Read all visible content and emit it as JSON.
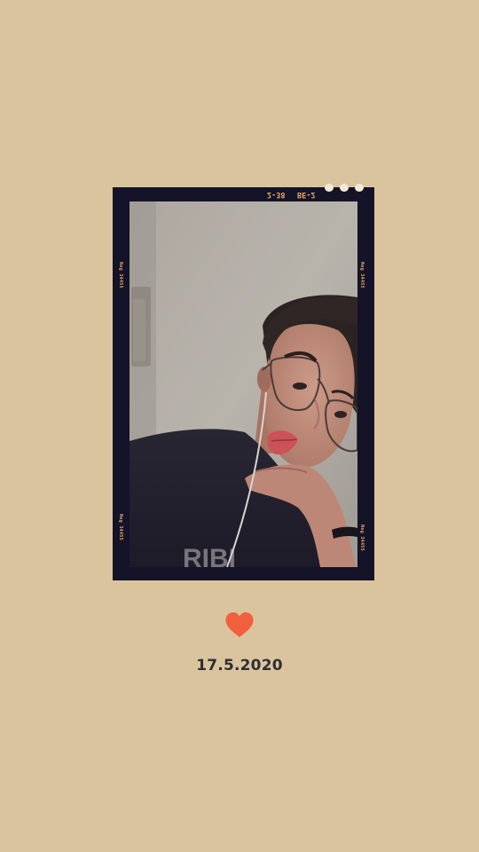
{
  "background_color": "#dac49d",
  "film": {
    "frame_color": "#141327",
    "code_left": "2-38",
    "code_right": "BE-2",
    "side_label": "Neg 34455",
    "perforation_color": "#f2ead8"
  },
  "photo": {
    "description_icon": "portrait-photo"
  },
  "heart": {
    "icon": "heart-icon",
    "color": "#f0603e"
  },
  "date": "17.5.2020"
}
